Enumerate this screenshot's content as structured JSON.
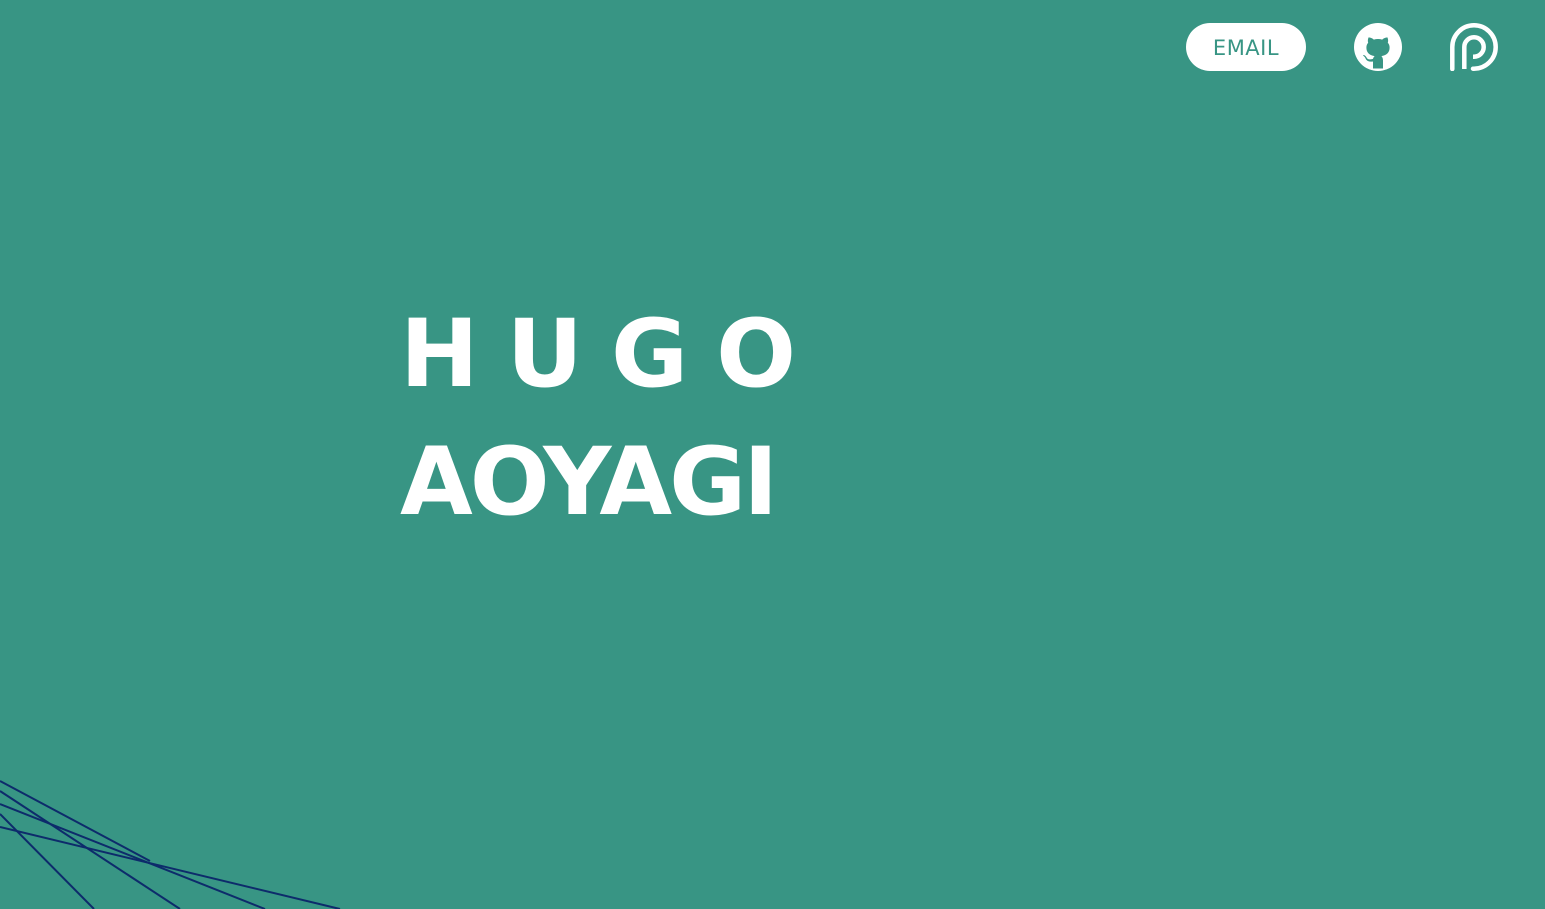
{
  "nav": {
    "email_label": "EMAIL",
    "github_icon": "github-icon",
    "patreon_icon": "patreon-icon"
  },
  "hero": {
    "first_name": "HUGO",
    "last_name": "AOYAGI"
  },
  "colors": {
    "background": "#389584",
    "foreground": "#ffffff",
    "accent_lines": "#0d2b6b"
  }
}
